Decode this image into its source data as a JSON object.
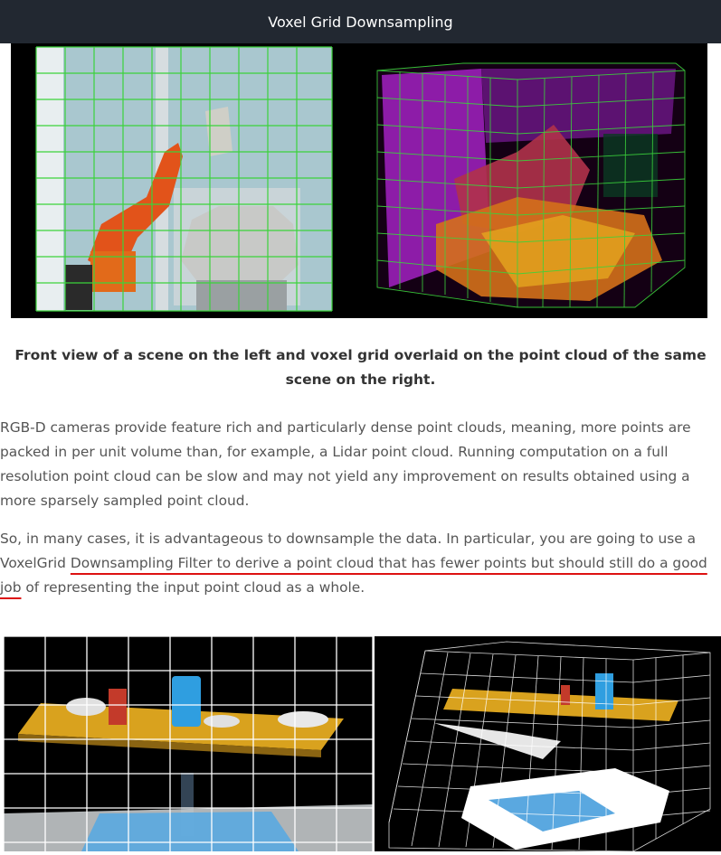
{
  "header": {
    "title": "Voxel Grid Downsampling"
  },
  "figure1": {
    "caption": "Front view of a scene on the left and voxel grid overlaid on the point cloud of the same scene on the right."
  },
  "paragraphs": {
    "p1": "RGB-D cameras provide feature rich and particularly dense point clouds, meaning, more points are packed in per unit volume than, for example, a Lidar point cloud. Running computation on a full resolution point cloud can be slow and may not yield any improvement on results obtained using a more sparsely sampled point cloud.",
    "p2_start": "So, in many cases, it is advantageous to downsample the data. In particular, you are going to use a VoxelGrid ",
    "p2_underlined": "Downsampling Filter to derive a point cloud that has fewer points but should still do a good job",
    "p2_end": " of representing the input point cloud as a whole."
  },
  "colors": {
    "header_bg": "#222831",
    "grid_green": "#3bd33b",
    "underline_red": "#dd1111",
    "voxel_magenta": "#a020c0",
    "table_orange": "#d9a21e",
    "floor_blue": "#5aa8e0"
  }
}
